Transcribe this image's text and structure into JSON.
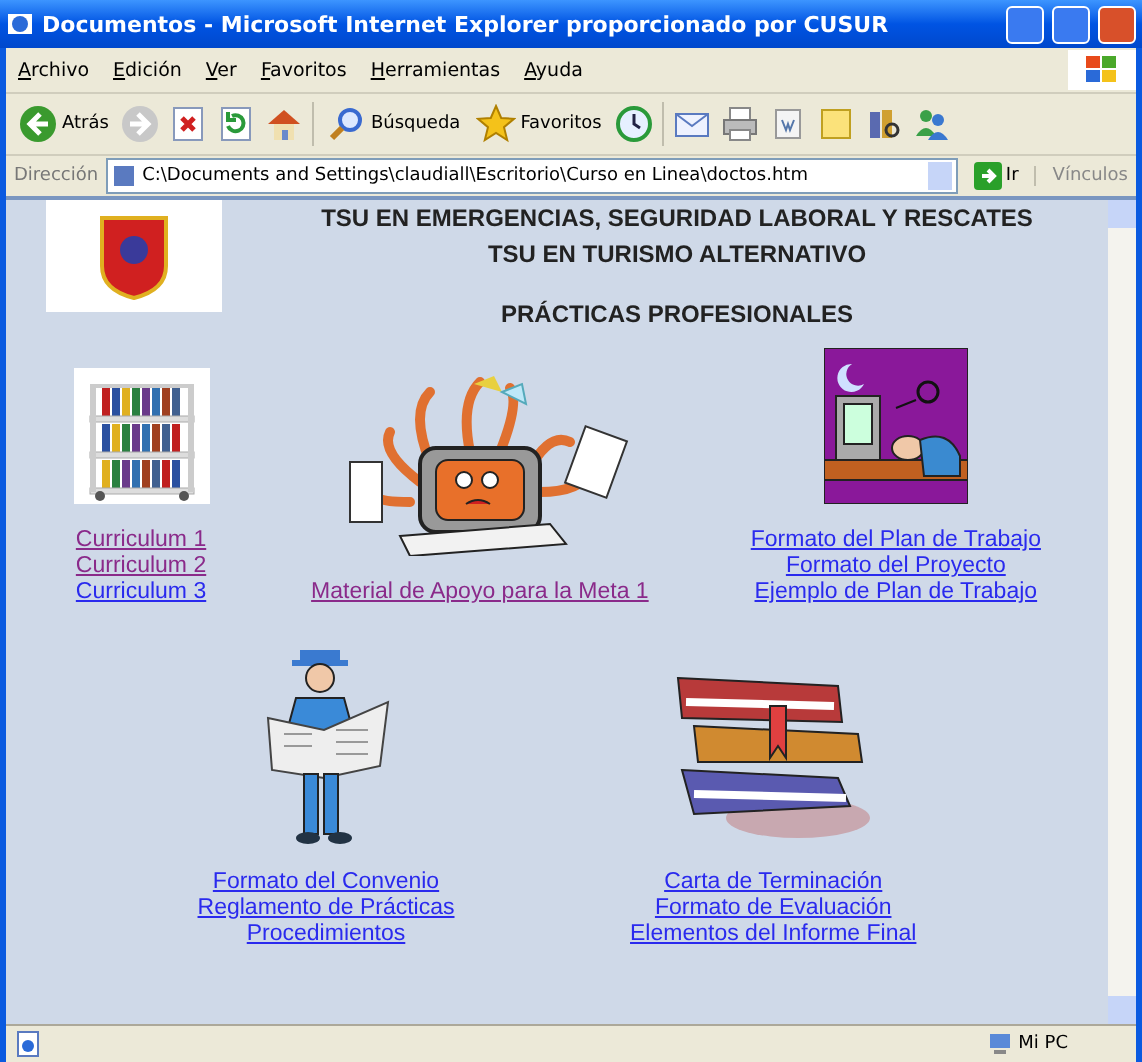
{
  "window": {
    "title": "Documentos - Microsoft Internet Explorer proporcionado por CUSUR"
  },
  "menu": [
    "Archivo",
    "Edición",
    "Ver",
    "Favoritos",
    "Herramientas",
    "Ayuda"
  ],
  "toolbar": [
    {
      "kind": "back",
      "label": "Atrás"
    },
    {
      "kind": "forward"
    },
    {
      "kind": "stop"
    },
    {
      "kind": "refresh"
    },
    {
      "kind": "home"
    },
    {
      "kind": "search",
      "label": "Búsqueda"
    },
    {
      "kind": "favorites",
      "label": "Favoritos"
    },
    {
      "kind": "history"
    },
    {
      "kind": "mail"
    },
    {
      "kind": "print"
    },
    {
      "kind": "edit"
    },
    {
      "kind": "notes"
    },
    {
      "kind": "research"
    },
    {
      "kind": "messenger"
    }
  ],
  "address": {
    "label": "Dirección",
    "value": "C:\\Documents and Settings\\claudiall\\Escritorio\\Curso en Linea\\doctos.htm",
    "go": "Ir",
    "links": "Vínculos"
  },
  "page": {
    "headings": [
      "TSU EN EMERGENCIAS, SEGURIDAD LABORAL Y RESCATES",
      "TSU EN TURISMO ALTERNATIVO",
      "PRÁCTICAS PROFESIONALES"
    ],
    "rows": [
      [
        {
          "kind": "book-cart",
          "links": [
            {
              "text": "Curriculum 1",
              "visited": true
            },
            {
              "text": "Curriculum 2",
              "visited": true
            },
            {
              "text": "Curriculum 3",
              "visited": false
            }
          ]
        },
        {
          "kind": "computer-monster",
          "links": [
            {
              "text": "Material de Apoyo para la Meta 1",
              "visited": true
            }
          ]
        },
        {
          "kind": "sleeping-worker",
          "links": [
            {
              "text": "Formato del Plan de Trabajo",
              "visited": false
            },
            {
              "text": "Formato del Proyecto",
              "visited": false
            },
            {
              "text": "Ejemplo de Plan de Trabajo",
              "visited": false
            }
          ]
        }
      ],
      [
        {
          "kind": "newspaper-reader",
          "links": [
            {
              "text": "Formato del Convenio",
              "visited": false
            },
            {
              "text": "Reglamento de Prácticas",
              "visited": false
            },
            {
              "text": "Procedimientos",
              "visited": false
            }
          ]
        },
        {
          "kind": "book-stack",
          "links": [
            {
              "text": "Carta de Terminación",
              "visited": false
            },
            {
              "text": "Formato de Evaluación",
              "visited": false
            },
            {
              "text": "Elementos del Informe Final",
              "visited": false
            }
          ]
        }
      ]
    ]
  },
  "status_bar": {
    "zone": "Mi PC"
  }
}
